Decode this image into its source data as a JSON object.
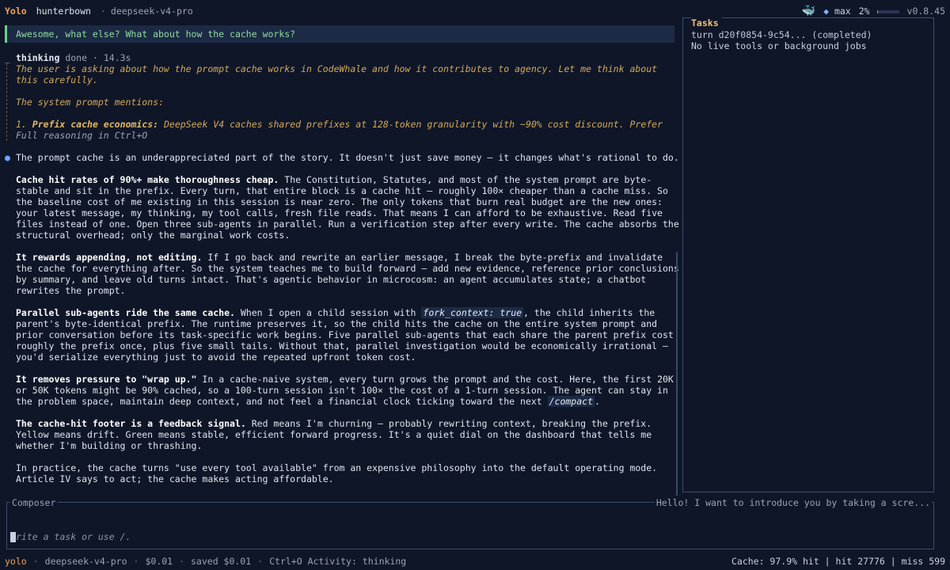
{
  "topbar": {
    "mode": "Yolo",
    "user": "hunterbown",
    "sep": "·",
    "model": "deepseek-v4-pro",
    "effort": "max",
    "context_pct": "2%",
    "context_fraction": 0.02,
    "version": "v0.8.45"
  },
  "transcript": {
    "user_message": "Awesome, what else? What about how the cache works?",
    "thinking": {
      "label": "thinking",
      "status": "done",
      "duration": "14.3s",
      "lines": [
        "The user is asking about how the prompt cache works in CodeWhale and how it contributes to agency. Let me think about this carefully.",
        "The system prompt mentions:"
      ],
      "point_number": "1.",
      "point_bold": "Prefix cache economics:",
      "point_rest": "DeepSeek V4 caches shared prefixes at 128-token granularity with ~90% cost discount. Prefer",
      "full_reasoning": "Full reasoning in Ctrl+O"
    },
    "answer": {
      "intro": "The prompt cache is an underappreciated part of the story. It doesn't just save money — it changes what's rational to do.",
      "p1_bold": "Cache hit rates of 90%+ make thoroughness cheap.",
      "p1_rest": "The Constitution, Statutes, and most of the system prompt are byte-stable and sit in the prefix. Every turn, that entire block is a cache hit — roughly 100× cheaper than a cache miss. So the baseline cost of me existing in this session is near zero. The only tokens that burn real budget are the new ones: your latest message, my thinking, my tool calls, fresh file reads. That means I can afford to be exhaustive. Read five files instead of one. Open three sub-agents in parallel. Run a verification step after every write. The cache absorbs the structural overhead; only the marginal work costs.",
      "p2_bold": "It rewards appending, not editing.",
      "p2_rest": "If I go back and rewrite an earlier message, I break the byte-prefix and invalidate the cache for everything after. So the system teaches me to build forward — add new evidence, reference prior conclusions by summary, and leave old turns intact. That's agentic behavior in microcosm: an agent accumulates state; a chatbot rewrites the prompt.",
      "p3_bold": "Parallel sub-agents ride the same cache.",
      "p3_a": "When I open a child session with",
      "p3_code1": "fork_context:",
      "p3_code2": "true",
      "p3_b": ", the child inherits the parent's byte-identical prefix. The runtime preserves it, so the child hits the cache on the entire system prompt and prior conversation before its task-specific work begins. Five parallel sub-agents that each share the parent prefix cost roughly the prefix once, plus five small tails. Without that, parallel investigation would be economically irrational — you'd serialize everything just to avoid the repeated upfront token cost.",
      "p4_bold": "It removes pressure to \"wrap up.\"",
      "p4_a": "In a cache-naive system, every turn grows the prompt and the cost. Here, the first 20K or 50K tokens might be 90% cached, so a 100-turn session isn't 100× the cost of a 1-turn session. The agent can stay in the problem space, maintain deep context, and not feel a financial clock ticking toward the next",
      "p4_code": "/compact",
      "p4_b": ".",
      "p5_bold": "The cache-hit footer is a feedback signal.",
      "p5_rest": "Red means I'm churning — probably rewriting context, breaking the prefix. Yellow means drift. Green means stable, efficient forward progress. It's a quiet dial on the dashboard that tells me whether I'm building or thrashing.",
      "p6": "In practice, the cache turns \"use every tool available\" from an expensive philosophy into the default operating mode. Article IV says to act; the cache makes acting affordable."
    }
  },
  "tasks": {
    "title": "Tasks",
    "turn": "turn d20f0854-9c54... (completed)",
    "empty": "No live tools or background jobs"
  },
  "composer": {
    "label": "Composer",
    "hint": "Hello! I want to introduce you by taking a scre...",
    "placeholder": "rite a task or use /."
  },
  "statusbar": {
    "mode": "yolo",
    "model": "deepseek-v4-pro",
    "cost": "$0.01",
    "saved": "saved $0.01",
    "activity": "Ctrl+O Activity: thinking",
    "cache": "Cache: 97.9% hit | hit 27776 | miss 599"
  },
  "colors": {
    "background": "#0f1628",
    "accent_orange": "#f0a35a",
    "user_green": "#8fdba0",
    "thinking_amber": "#d2a95a",
    "dot_blue": "#6fa4ff"
  },
  "icons": {
    "whale": "whale-icon",
    "diamond": "diamond-icon",
    "answer_dot": "bullet-dot-icon"
  }
}
